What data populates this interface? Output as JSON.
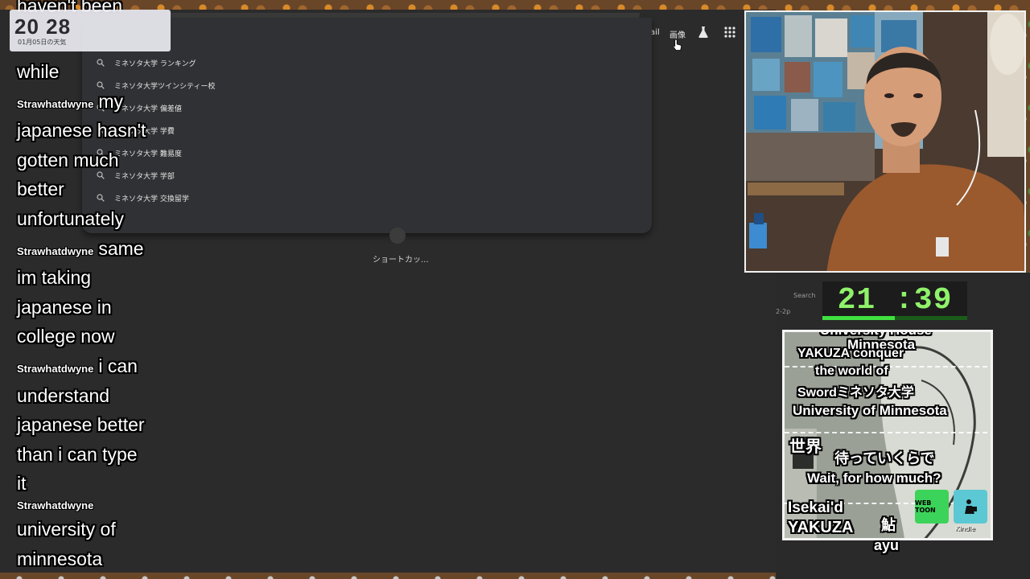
{
  "weather": {
    "time": "20 28",
    "date": "01月05日の天気"
  },
  "browser": {
    "gmail": "ail",
    "images": "画像",
    "suggestions": [
      "ミネソタ大学 ランキング",
      "ミネソタ大学ツインシティー校",
      "ミネソタ大学 偏差値",
      "ミネソタ大学 学費",
      "ミネソタ大学 難易度",
      "ミネソタ大学 学部",
      "ミネソタ大学 交換留学"
    ],
    "shortcut_label": "ショートカッ..."
  },
  "chat": {
    "lines": [
      {
        "user": "",
        "text": "haven't been"
      },
      {
        "user": "",
        "text": "while"
      },
      {
        "user": "Strawhatdwyne",
        "text": "my"
      },
      {
        "user": "",
        "text": "japanese hasn't"
      },
      {
        "user": "",
        "text": "gotten much"
      },
      {
        "user": "",
        "text": "better"
      },
      {
        "user": "",
        "text": "unfortunately"
      },
      {
        "user": "Strawhatdwyne",
        "text": "same"
      },
      {
        "user": "",
        "text": "im taking"
      },
      {
        "user": "",
        "text": "japanese in"
      },
      {
        "user": "",
        "text": "college now"
      },
      {
        "user": "Strawhatdwyne",
        "text": "i can"
      },
      {
        "user": "",
        "text": "understand"
      },
      {
        "user": "",
        "text": "japanese better"
      },
      {
        "user": "",
        "text": "than i can type"
      },
      {
        "user": "",
        "text": "it"
      },
      {
        "user": "Strawhatdwyne",
        "text": ""
      },
      {
        "user": "",
        "text": "university of"
      },
      {
        "user": "",
        "text": "minnesota"
      }
    ]
  },
  "timer": {
    "value": "21 :39",
    "progress": 0.5
  },
  "overlay": {
    "line_univ_house": "University House",
    "line_minnesota": "Minnesota",
    "line_yakuza1": "YAKUZA conquer",
    "line_yakuza2": "the world of",
    "line_yakuza3": "Swordミネソタ大学",
    "line_univ": "University of Minnesota",
    "line_matte": "待っていくらで",
    "line_wait": "Wait, for how much?",
    "line_isekai1": "Isekai'd",
    "line_isekai2": "YAKUZA",
    "line_ayu_jp": "鮎",
    "line_ayu": "ayu",
    "webtoon_label": "WEB TOON",
    "kindle_label": "Kindle",
    "side_label": "世界"
  },
  "side_panel": {
    "search": "Search",
    "time_range": "2-2p"
  },
  "colors": {
    "timer_green": "#8ff26a",
    "panel_dark": "#303134",
    "webtoon": "#3cd35a"
  }
}
